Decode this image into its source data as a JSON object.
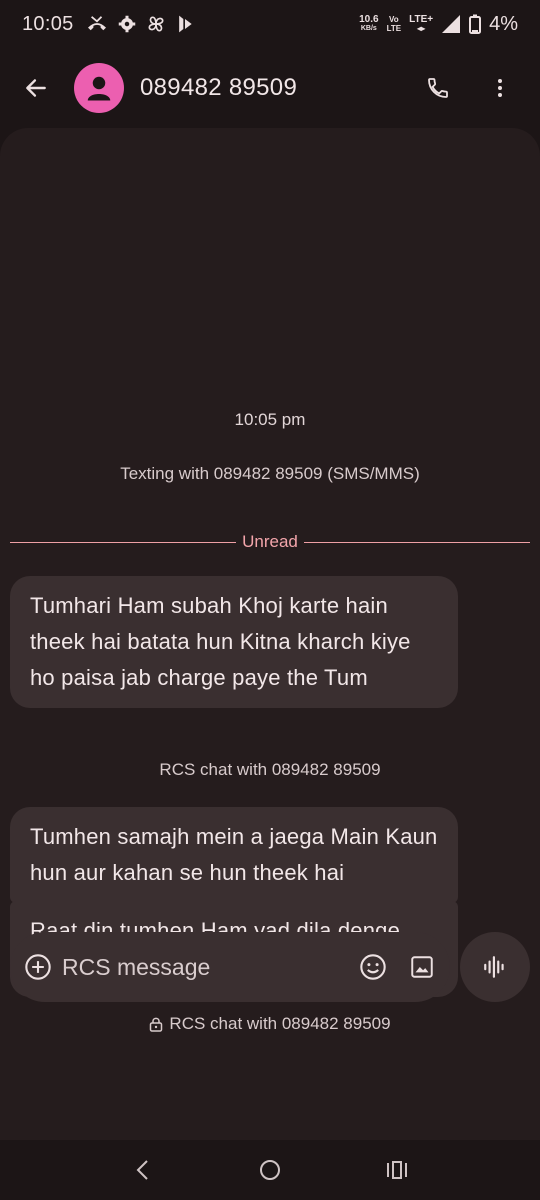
{
  "status_bar": {
    "time": "10:05",
    "net_speed_value": "10.6",
    "net_speed_unit": "KB/s",
    "volte_top": "Vo",
    "volte_bottom": "LTE",
    "lte": "LTE+",
    "battery": "4%"
  },
  "header": {
    "contact": "089482 89509"
  },
  "conversation": {
    "timestamp": "10:05 pm",
    "texting_with": "Texting with 089482 89509 (SMS/MMS)",
    "unread_label": "Unread",
    "messages": [
      {
        "text": "Tumhari Ham subah Khoj karte hain theek hai batata hun Kitna kharch kiye ho paisa jab charge paye the Tum"
      },
      {
        "text": "Tumhen samajh mein a jaega Main Kaun hun aur kahan se hun theek hai"
      },
      {
        "text": "Raat din tumhen Ham yad dila denge duty kya hoti hai"
      }
    ],
    "rcs_note_1": "RCS chat with 089482 89509",
    "rcs_note_2": "RCS chat with 089482 89509"
  },
  "composer": {
    "placeholder": "RCS message"
  },
  "icons": {
    "back": "arrow-left-icon",
    "phone": "phone-icon",
    "more": "more-vert-icon",
    "add": "add-circle-icon",
    "emoji": "emoji-icon",
    "gallery": "image-icon",
    "voice": "voice-waveform-icon",
    "lock": "lock-icon"
  },
  "colors": {
    "background": "#1c1516",
    "panel": "#251c1d",
    "bubble": "#3a2f30",
    "avatar": "#ec5fb0",
    "unread_accent": "#f3a5ab"
  }
}
